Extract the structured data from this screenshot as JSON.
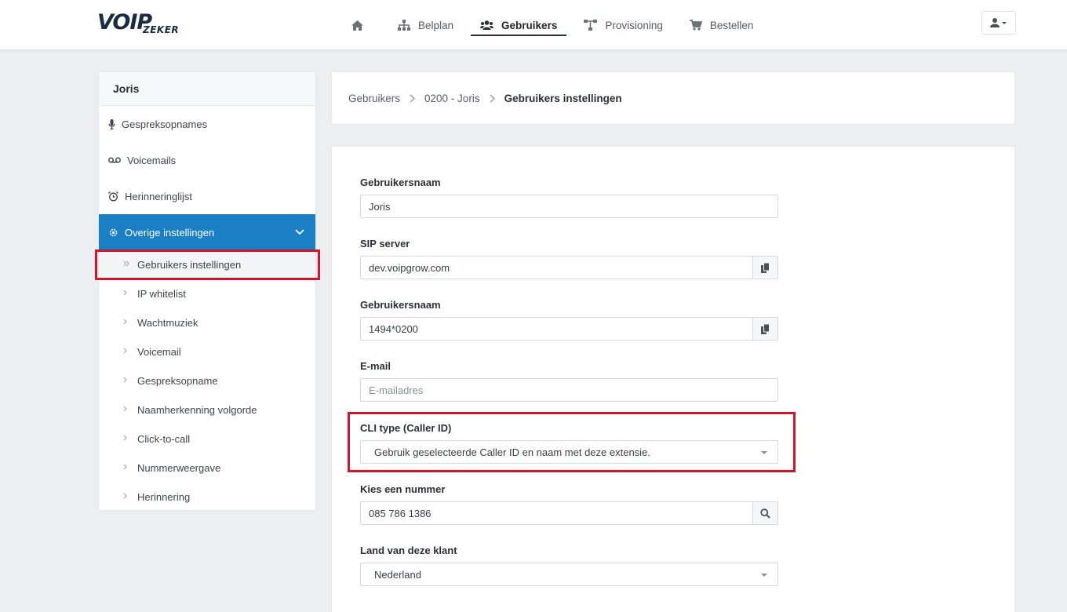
{
  "brand": {
    "logo_text_main": "VOIP",
    "logo_text_sub": "ZEKER"
  },
  "nav": {
    "items": [
      {
        "label": "",
        "icon": "home-icon"
      },
      {
        "label": "Belplan",
        "icon": "sitemap-icon"
      },
      {
        "label": "Gebruikers",
        "icon": "users-icon",
        "active": true
      },
      {
        "label": "Provisioning",
        "icon": "network-icon"
      },
      {
        "label": "Bestellen",
        "icon": "cart-icon"
      }
    ]
  },
  "user_menu": {
    "icon": "user-icon"
  },
  "sidebar": {
    "title": "Joris",
    "items": [
      {
        "label": "Gespreksopnames",
        "icon": "microphone-icon"
      },
      {
        "label": "Voicemails",
        "icon": "voicemail-icon"
      },
      {
        "label": "Herinneringlijst",
        "icon": "alarm-clock-icon"
      },
      {
        "label": "Overige instellingen",
        "icon": "gear-icon",
        "active": true
      }
    ],
    "sub_items": [
      {
        "label": "Gebruikers instellingen",
        "selected": true
      },
      {
        "label": "IP whitelist"
      },
      {
        "label": "Wachtmuziek"
      },
      {
        "label": "Voicemail"
      },
      {
        "label": "Gespreksopname"
      },
      {
        "label": "Naamherkenning volgorde"
      },
      {
        "label": "Click-to-call"
      },
      {
        "label": "Nummerweergave"
      },
      {
        "label": "Herinnering"
      }
    ]
  },
  "breadcrumb": {
    "items": [
      "Gebruikers",
      "0200 - Joris"
    ],
    "current": "Gebruikers instellingen"
  },
  "form": {
    "username": {
      "label": "Gebruikersnaam",
      "value": "Joris"
    },
    "sip_server": {
      "label": "SIP server",
      "value": "dev.voipgrow.com"
    },
    "sip_username": {
      "label": "Gebruikersnaam",
      "value": "1494*0200"
    },
    "email": {
      "label": "E-mail",
      "placeholder": "E-mailadres"
    },
    "cli_type": {
      "label": "CLI type (Caller ID)",
      "value": "Gebruik geselecteerde Caller ID en naam met deze extensie."
    },
    "number": {
      "label": "Kies een nummer",
      "value": "085 786 1386"
    },
    "country": {
      "label": "Land van deze klant",
      "value": "Nederland"
    }
  },
  "colors": {
    "accent": "#1b7fc6",
    "highlight": "#d3142c"
  }
}
